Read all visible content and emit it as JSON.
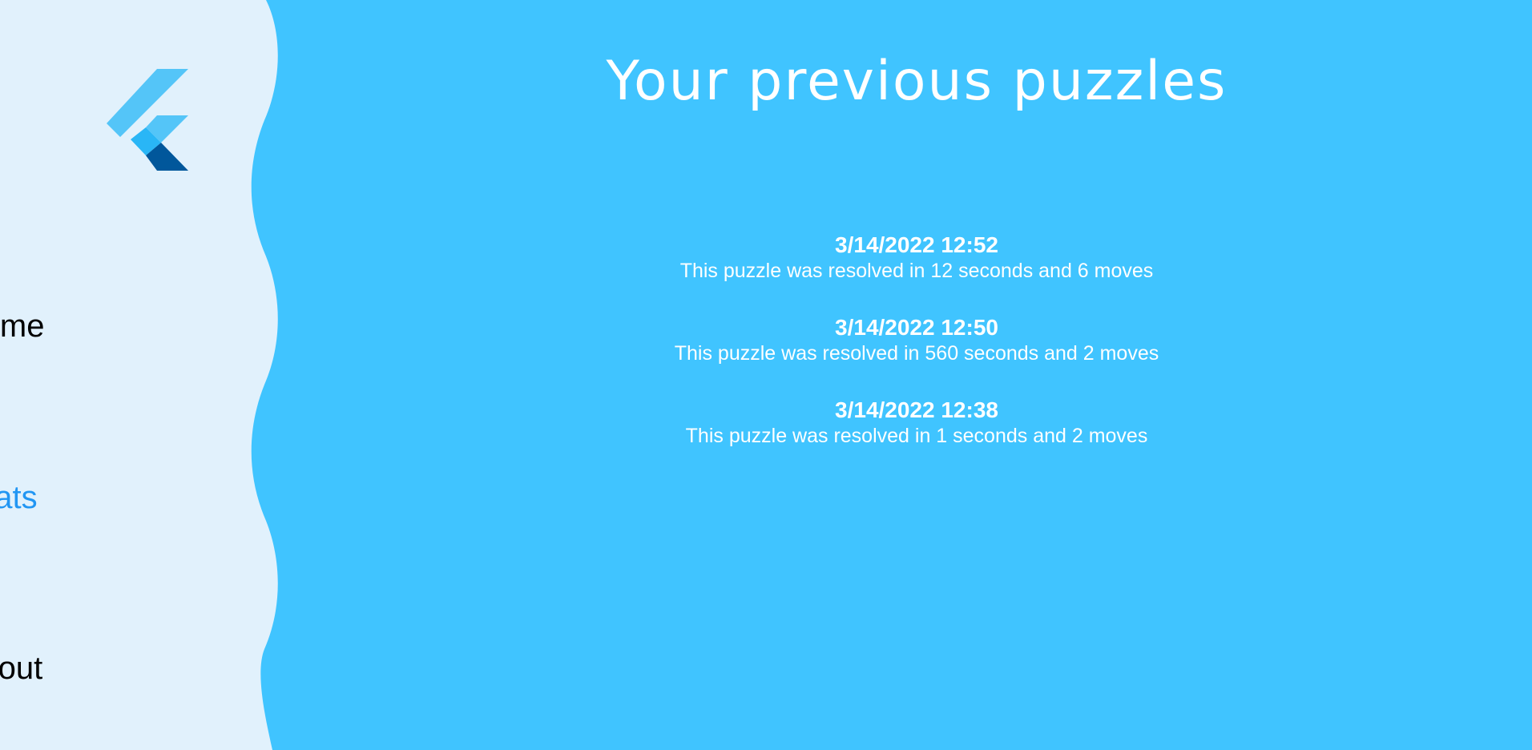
{
  "colors": {
    "main_background": "#40C4FF",
    "sidebar_background": "#E1F1FC",
    "nav_active": "#2196F3",
    "nav_inactive": "#000000"
  },
  "sidebar": {
    "logo_icon": "flutter-logo-icon",
    "items": [
      {
        "label": "Game",
        "active": false
      },
      {
        "label": "Stats",
        "active": true
      },
      {
        "label": "About",
        "active": false
      }
    ]
  },
  "main": {
    "title": "Your previous puzzles",
    "puzzles": [
      {
        "date": "3/14/2022 12:52",
        "description": "This puzzle was resolved in 12 seconds and 6 moves"
      },
      {
        "date": "3/14/2022 12:50",
        "description": "This puzzle was resolved in 560 seconds and 2 moves"
      },
      {
        "date": "3/14/2022 12:38",
        "description": "This puzzle was resolved in 1 seconds and 2 moves"
      }
    ]
  }
}
